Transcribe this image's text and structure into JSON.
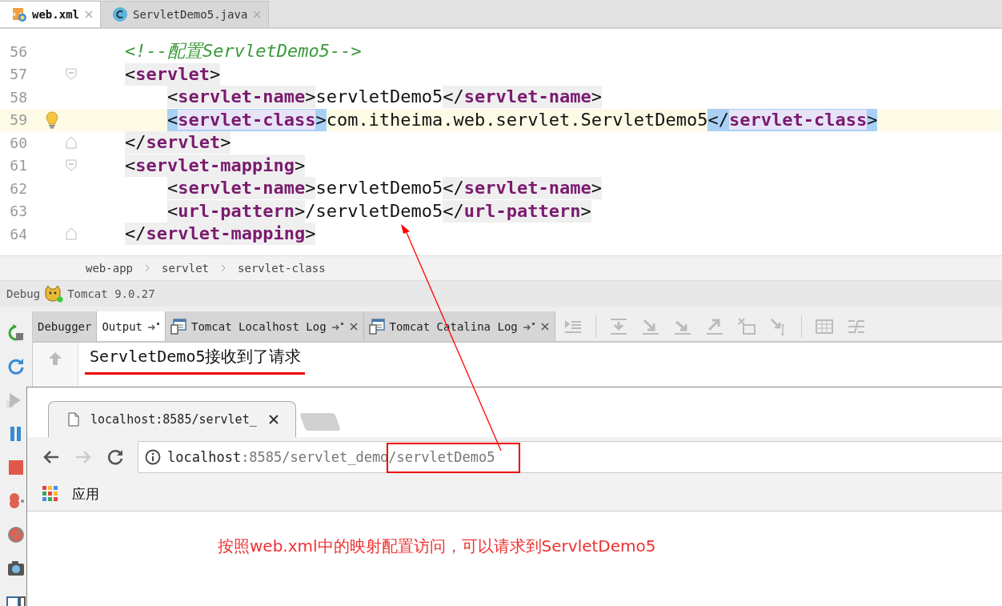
{
  "editor": {
    "tabs": [
      {
        "label": "web.xml",
        "selected": true
      },
      {
        "label": "ServletDemo5.java",
        "selected": false
      }
    ],
    "lines": [
      {
        "number": "56",
        "current": false,
        "bulb": false,
        "fold_end": false,
        "segments": [
          {
            "kind": "comment",
            "text": "<!--配置ServletDemo5-->"
          }
        ]
      },
      {
        "number": "57",
        "current": false,
        "bulb": false,
        "fold_end": false,
        "segments": [
          {
            "kind": "tag",
            "text": "<servlet>"
          }
        ],
        "children": [
          {
            "number": "58",
            "current": false,
            "bulb": false,
            "fold_end": false,
            "segments": [
              {
                "kind": "tag",
                "text": "<servlet-name>",
                "matched": false
              },
              {
                "kind": "text",
                "text": "servletDemo5"
              },
              {
                "kind": "tag",
                "text": "</servlet-name>",
                "matched": false
              }
            ]
          },
          {
            "number": "59",
            "current": true,
            "bulb": true,
            "fold_end": false,
            "segments": [
              {
                "kind": "tag",
                "text": "<servlet-class>",
                "matched": true
              },
              {
                "kind": "text",
                "text": "com.itheima.web.servlet.ServletDemo5"
              },
              {
                "kind": "tag",
                "text": "</servlet-class>",
                "matched": true
              }
            ]
          }
        ]
      },
      {
        "number": "60",
        "current": false,
        "bulb": false,
        "fold_end": true,
        "segments": [
          {
            "kind": "tag",
            "text": "</servlet>"
          }
        ]
      },
      {
        "number": "61",
        "current": false,
        "bulb": false,
        "fold_end": false,
        "segments": [
          {
            "kind": "tag",
            "text": "<servlet-mapping>"
          }
        ],
        "children": [
          {
            "number": "62",
            "current": false,
            "bulb": false,
            "fold_end": false,
            "segments": [
              {
                "kind": "tag",
                "text": "<servlet-name>",
                "matched": false
              },
              {
                "kind": "text",
                "text": "servletDemo5"
              },
              {
                "kind": "tag",
                "text": "</servlet-name>",
                "matched": false
              }
            ]
          },
          {
            "number": "63",
            "current": false,
            "bulb": false,
            "fold_end": false,
            "segments": [
              {
                "kind": "tag",
                "text": "<url-pattern>",
                "matched": false
              },
              {
                "kind": "text",
                "text": "/servletDemo5"
              },
              {
                "kind": "tag",
                "text": "</url-pattern>",
                "matched": false
              }
            ]
          }
        ]
      },
      {
        "number": "64",
        "current": false,
        "bulb": false,
        "fold_end": true,
        "segments": [
          {
            "kind": "tag",
            "text": "</servlet-mapping>"
          }
        ]
      }
    ],
    "breadcrumbs": [
      "web-app",
      "servlet",
      "servlet-class"
    ]
  },
  "debug": {
    "title": "Debug",
    "config": "Tomcat 9.0.27",
    "tabs": [
      {
        "label": "Debugger",
        "selected": false,
        "log_icon": false,
        "pin": false,
        "close": false
      },
      {
        "label": "Output",
        "selected": true,
        "log_icon": false,
        "pin": true,
        "close": false
      },
      {
        "label": "Tomcat Localhost Log",
        "selected": false,
        "log_icon": true,
        "pin": true,
        "close": true
      },
      {
        "label": "Tomcat Catalina Log",
        "selected": false,
        "log_icon": true,
        "pin": true,
        "close": true
      }
    ],
    "output": [
      {
        "text": "ServletDemo5接收到了请求",
        "underlined": true
      }
    ]
  },
  "browser": {
    "tab": {
      "title": "localhost:8585/servlet_"
    },
    "url": [
      {
        "kind": "host",
        "text": "localhost"
      },
      {
        "kind": "path",
        "text": ":8585/servlet_demo",
        "boxed": false
      },
      {
        "kind": "path",
        "text": "/servletDemo5",
        "boxed": true
      }
    ],
    "bookmarks": [
      {
        "label": "应用"
      }
    ],
    "note": "按照web.xml中的映射配置访问，可以请求到ServletDemo5"
  }
}
